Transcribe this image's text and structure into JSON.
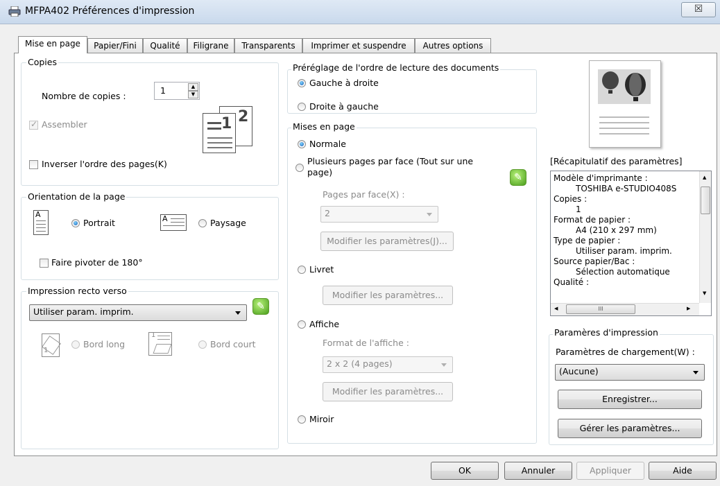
{
  "window": {
    "title": "MFPA402 Préférences d'impression",
    "close_glyph": "☒"
  },
  "tabs": [
    "Mise en page",
    "Papier/Fini",
    "Qualité",
    "Filigrane",
    "Transparents",
    "Imprimer et suspendre",
    "Autres options"
  ],
  "copies": {
    "legend": "Copies",
    "count_label": "Nombre de copies :",
    "count_value": "1",
    "collate_label": "Assembler",
    "reverse_label": "Inverser l'ordre des pages(K)"
  },
  "orientation": {
    "legend": "Orientation de la page",
    "portrait_label": "Portrait",
    "landscape_label": "Paysage",
    "rotate_label": "Faire pivoter de 180°"
  },
  "duplex": {
    "legend": "Impression recto verso",
    "selected": "Utiliser param. imprim.",
    "long_edge_label": "Bord long",
    "short_edge_label": "Bord court"
  },
  "reading_order": {
    "legend": "Préréglage de l'ordre de lecture des documents",
    "ltr_label": "Gauche à droite",
    "rtl_label": "Droite à gauche"
  },
  "layout": {
    "legend": "Mises en page",
    "normal_label": "Normale",
    "multi_label_line1": "Plusieurs pages par face (Tout sur une",
    "multi_label_line2": "page)",
    "pages_per_side_label": "Pages par face(X) :",
    "pages_per_side_value": "2",
    "multi_settings_button": "Modifier les paramètres(J)...",
    "booklet_label": "Livret",
    "booklet_settings_button": "Modifier les paramètres...",
    "poster_label": "Affiche",
    "poster_format_label": "Format de l'affiche :",
    "poster_format_value": "2 x 2 (4 pages)",
    "poster_settings_button": "Modifier les paramètres...",
    "mirror_label": "Miroir"
  },
  "summary": {
    "title": "[Récapitulatif des paramètres]",
    "lines": [
      {
        "text": "Modèle d'imprimante :",
        "indent": false
      },
      {
        "text": "TOSHIBA e-STUDIO408S",
        "indent": true
      },
      {
        "text": "Copies :",
        "indent": false
      },
      {
        "text": "1",
        "indent": true
      },
      {
        "text": "Format de papier :",
        "indent": false
      },
      {
        "text": "A4 (210 x 297 mm)",
        "indent": true
      },
      {
        "text": "Type de papier :",
        "indent": false
      },
      {
        "text": "Utiliser param. imprim.",
        "indent": true
      },
      {
        "text": "Source papier/Bac :",
        "indent": false
      },
      {
        "text": "Sélection automatique",
        "indent": true
      },
      {
        "text": "Qualité :",
        "indent": false
      }
    ],
    "hscroll_thumb": "III"
  },
  "print_settings": {
    "legend": "Paramères d'impression",
    "load_label": "Paramètres de chargement(W) :",
    "load_value": "(Aucune)",
    "save_button": "Enregistrer...",
    "manage_button": "Gérer les paramètres..."
  },
  "footer": {
    "ok": "OK",
    "cancel": "Annuler",
    "apply": "Appliquer",
    "help": "Aide"
  },
  "icons": {
    "page_number_1": "1",
    "page_number_2": "2",
    "leaf_glyph": "✎"
  }
}
